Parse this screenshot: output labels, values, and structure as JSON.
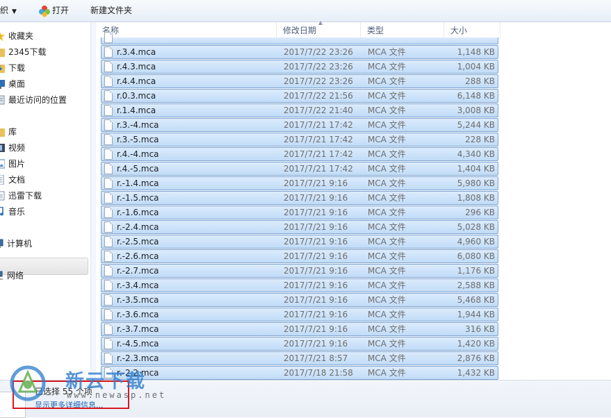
{
  "toolbar": {
    "organize_label": "织",
    "open_label": "打开",
    "new_folder_label": "新建文件夹"
  },
  "nav": {
    "favorites": "收藏夹",
    "fav_items": [
      "2345下载",
      "下载",
      "桌面",
      "最近访问的位置"
    ],
    "libraries": "库",
    "lib_items": [
      "视频",
      "图片",
      "文档",
      "迅雷下载",
      "音乐"
    ],
    "computer": "计算机",
    "network": "网络"
  },
  "columns": {
    "name": "名称",
    "date": "修改日期",
    "type": "类型",
    "size": "大小"
  },
  "files": [
    {
      "name": "r.3.4.mca",
      "date": "2017/7/22 23:26",
      "type": "MCA 文件",
      "size": "1,148 KB"
    },
    {
      "name": "r.4.3.mca",
      "date": "2017/7/22 23:26",
      "type": "MCA 文件",
      "size": "1,004 KB"
    },
    {
      "name": "r.4.4.mca",
      "date": "2017/7/22 23:26",
      "type": "MCA 文件",
      "size": "288 KB"
    },
    {
      "name": "r.0.3.mca",
      "date": "2017/7/22 21:56",
      "type": "MCA 文件",
      "size": "6,148 KB"
    },
    {
      "name": "r.1.4.mca",
      "date": "2017/7/22 21:40",
      "type": "MCA 文件",
      "size": "3,008 KB"
    },
    {
      "name": "r.3.-4.mca",
      "date": "2017/7/21 17:42",
      "type": "MCA 文件",
      "size": "5,244 KB"
    },
    {
      "name": "r.3.-5.mca",
      "date": "2017/7/21 17:42",
      "type": "MCA 文件",
      "size": "228 KB"
    },
    {
      "name": "r.4.-4.mca",
      "date": "2017/7/21 17:42",
      "type": "MCA 文件",
      "size": "4,340 KB"
    },
    {
      "name": "r.4.-5.mca",
      "date": "2017/7/21 17:42",
      "type": "MCA 文件",
      "size": "1,404 KB"
    },
    {
      "name": "r.-1.4.mca",
      "date": "2017/7/21 9:16",
      "type": "MCA 文件",
      "size": "5,980 KB"
    },
    {
      "name": "r.-1.5.mca",
      "date": "2017/7/21 9:16",
      "type": "MCA 文件",
      "size": "1,808 KB"
    },
    {
      "name": "r.-1.6.mca",
      "date": "2017/7/21 9:16",
      "type": "MCA 文件",
      "size": "296 KB"
    },
    {
      "name": "r.-2.4.mca",
      "date": "2017/7/21 9:16",
      "type": "MCA 文件",
      "size": "5,028 KB"
    },
    {
      "name": "r.-2.5.mca",
      "date": "2017/7/21 9:16",
      "type": "MCA 文件",
      "size": "4,960 KB"
    },
    {
      "name": "r.-2.6.mca",
      "date": "2017/7/21 9:16",
      "type": "MCA 文件",
      "size": "6,080 KB"
    },
    {
      "name": "r.-2.7.mca",
      "date": "2017/7/21 9:16",
      "type": "MCA 文件",
      "size": "1,176 KB"
    },
    {
      "name": "r.-3.4.mca",
      "date": "2017/7/21 9:16",
      "type": "MCA 文件",
      "size": "2,588 KB"
    },
    {
      "name": "r.-3.5.mca",
      "date": "2017/7/21 9:16",
      "type": "MCA 文件",
      "size": "5,468 KB"
    },
    {
      "name": "r.-3.6.mca",
      "date": "2017/7/21 9:16",
      "type": "MCA 文件",
      "size": "1,944 KB"
    },
    {
      "name": "r.-3.7.mca",
      "date": "2017/7/21 9:16",
      "type": "MCA 文件",
      "size": "316 KB"
    },
    {
      "name": "r.-4.5.mca",
      "date": "2017/7/21 9:16",
      "type": "MCA 文件",
      "size": "1,420 KB"
    },
    {
      "name": "r.-2.3.mca",
      "date": "2017/7/21 8:57",
      "type": "MCA 文件",
      "size": "2,876 KB"
    },
    {
      "name": "r.-2.2.mca",
      "date": "2017/7/18 21:58",
      "type": "MCA 文件",
      "size": "1,432 KB"
    }
  ],
  "details": {
    "selected_text": "已选择 55 个项",
    "more_link": "显示更多详细信息..."
  },
  "watermark": {
    "cn": "新云下载",
    "url": "www.newasp.net"
  },
  "colors": {
    "selection_fill": "#cce1f9",
    "selection_border": "#7da2ce",
    "highlight_box": "#d9161e",
    "link": "#1a5fb4"
  }
}
